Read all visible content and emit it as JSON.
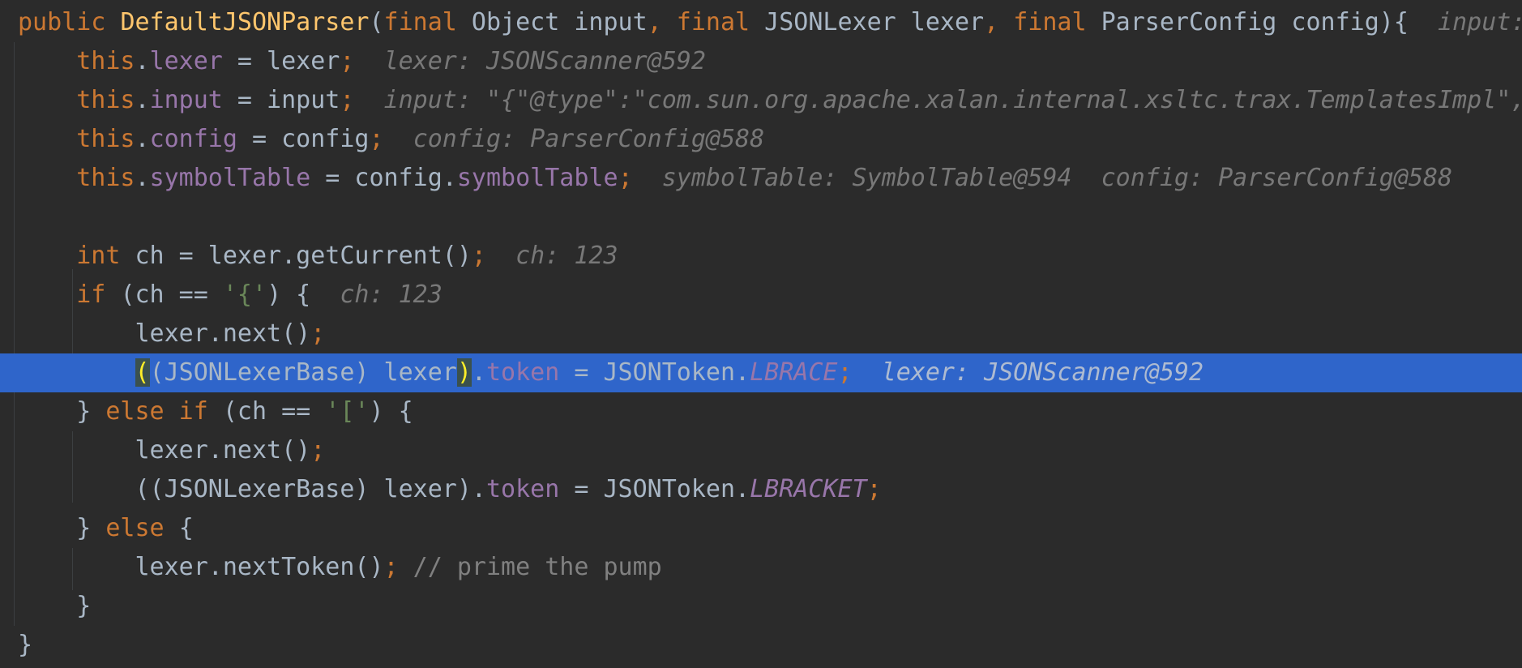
{
  "lines": [
    {
      "indent": "",
      "tokens": [
        {
          "t": "public ",
          "c": "kw"
        },
        {
          "t": "DefaultJSONParser",
          "c": "fn"
        },
        {
          "t": "(",
          "c": "ty"
        },
        {
          "t": "final ",
          "c": "kw"
        },
        {
          "t": "Object input",
          "c": "ty"
        },
        {
          "t": ", ",
          "c": "kw"
        },
        {
          "t": "final ",
          "c": "kw"
        },
        {
          "t": "JSONLexer lexer",
          "c": "ty"
        },
        {
          "t": ", ",
          "c": "kw"
        },
        {
          "t": "final ",
          "c": "kw"
        },
        {
          "t": "ParserConfig config){",
          "c": "ty"
        }
      ],
      "hint": "input: "
    },
    {
      "indent": "    ",
      "tokens": [
        {
          "t": "this",
          "c": "kw"
        },
        {
          "t": ".",
          "c": "ty"
        },
        {
          "t": "lexer",
          "c": "fld"
        },
        {
          "t": " = lexer",
          "c": "ty"
        },
        {
          "t": ";",
          "c": "kw"
        }
      ],
      "hint": "lexer: JSONScanner@592"
    },
    {
      "indent": "    ",
      "tokens": [
        {
          "t": "this",
          "c": "kw"
        },
        {
          "t": ".",
          "c": "ty"
        },
        {
          "t": "input",
          "c": "fld"
        },
        {
          "t": " = input",
          "c": "ty"
        },
        {
          "t": ";",
          "c": "kw"
        }
      ],
      "hint": "input: \"{\"@type\":\"com.sun.org.apache.xalan.internal.xsltc.trax.TemplatesImpl\","
    },
    {
      "indent": "    ",
      "tokens": [
        {
          "t": "this",
          "c": "kw"
        },
        {
          "t": ".",
          "c": "ty"
        },
        {
          "t": "config",
          "c": "fld"
        },
        {
          "t": " = config",
          "c": "ty"
        },
        {
          "t": ";",
          "c": "kw"
        }
      ],
      "hint": "config: ParserConfig@588"
    },
    {
      "indent": "    ",
      "tokens": [
        {
          "t": "this",
          "c": "kw"
        },
        {
          "t": ".",
          "c": "ty"
        },
        {
          "t": "symbolTable",
          "c": "fld"
        },
        {
          "t": " = config.",
          "c": "ty"
        },
        {
          "t": "symbolTable",
          "c": "fld"
        },
        {
          "t": ";",
          "c": "kw"
        }
      ],
      "hint": "symbolTable: SymbolTable@594  config: ParserConfig@588"
    },
    {
      "indent": "",
      "tokens": [],
      "hint": ""
    },
    {
      "indent": "    ",
      "tokens": [
        {
          "t": "int ",
          "c": "kw"
        },
        {
          "t": "ch = lexer.getCurrent()",
          "c": "ty"
        },
        {
          "t": ";",
          "c": "kw"
        }
      ],
      "hint": "ch: 123"
    },
    {
      "indent": "    ",
      "tokens": [
        {
          "t": "if ",
          "c": "kw"
        },
        {
          "t": "(ch == ",
          "c": "ty"
        },
        {
          "t": "'{'",
          "c": "str"
        },
        {
          "t": ") {",
          "c": "ty"
        }
      ],
      "hint": "ch: 123"
    },
    {
      "indent": "        ",
      "tokens": [
        {
          "t": "lexer.next()",
          "c": "ty"
        },
        {
          "t": ";",
          "c": "kw"
        }
      ],
      "hint": ""
    },
    {
      "indent": "        ",
      "current": true,
      "tokens": [
        {
          "t": "(",
          "c": "bracket-hl"
        },
        {
          "t": "(JSONLexerBase) lexer",
          "c": "ty"
        },
        {
          "t": ")",
          "c": "bracket-hl"
        },
        {
          "t": ".",
          "c": "ty"
        },
        {
          "t": "token",
          "c": "fld"
        },
        {
          "t": " = JSONToken.",
          "c": "ty"
        },
        {
          "t": "LBRACE",
          "c": "cst"
        },
        {
          "t": ";",
          "c": "kw"
        }
      ],
      "hint": "lexer: JSONScanner@592"
    },
    {
      "indent": "    ",
      "tokens": [
        {
          "t": "} ",
          "c": "ty"
        },
        {
          "t": "else if ",
          "c": "kw"
        },
        {
          "t": "(ch == ",
          "c": "ty"
        },
        {
          "t": "'['",
          "c": "str"
        },
        {
          "t": ") {",
          "c": "ty"
        }
      ],
      "hint": ""
    },
    {
      "indent": "        ",
      "tokens": [
        {
          "t": "lexer.next()",
          "c": "ty"
        },
        {
          "t": ";",
          "c": "kw"
        }
      ],
      "hint": ""
    },
    {
      "indent": "        ",
      "tokens": [
        {
          "t": "((JSONLexerBase) lexer).",
          "c": "ty"
        },
        {
          "t": "token",
          "c": "fld"
        },
        {
          "t": " = JSONToken.",
          "c": "ty"
        },
        {
          "t": "LBRACKET",
          "c": "cst"
        },
        {
          "t": ";",
          "c": "kw"
        }
      ],
      "hint": ""
    },
    {
      "indent": "    ",
      "tokens": [
        {
          "t": "} ",
          "c": "ty"
        },
        {
          "t": "else ",
          "c": "kw"
        },
        {
          "t": "{",
          "c": "ty"
        }
      ],
      "hint": ""
    },
    {
      "indent": "        ",
      "tokens": [
        {
          "t": "lexer.nextToken()",
          "c": "ty"
        },
        {
          "t": "; ",
          "c": "kw"
        },
        {
          "t": "// prime the pump",
          "c": "cmt"
        }
      ],
      "hint": ""
    },
    {
      "indent": "    ",
      "tokens": [
        {
          "t": "}",
          "c": "ty"
        }
      ],
      "hint": ""
    },
    {
      "indent": "",
      "tokens": [
        {
          "t": "}",
          "c": "ty"
        }
      ],
      "hint": ""
    }
  ]
}
